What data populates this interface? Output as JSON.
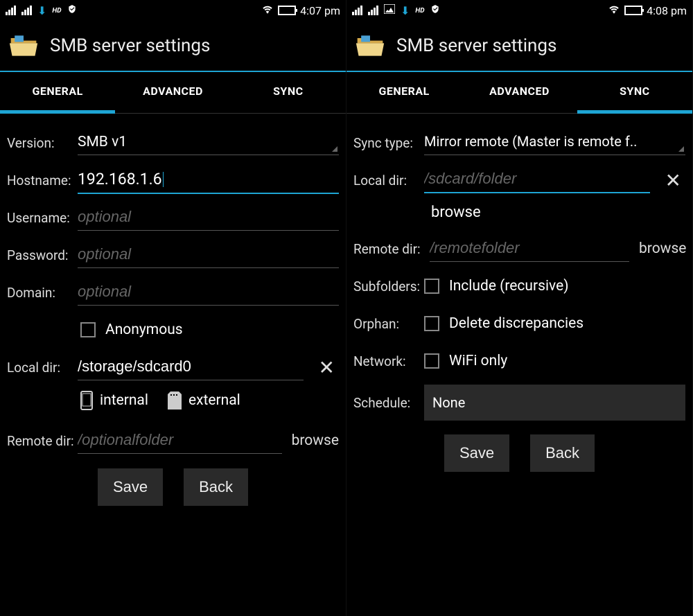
{
  "left": {
    "statusbar": {
      "hd": "HD",
      "time": "4:07 pm"
    },
    "title": "SMB server settings",
    "tabs": {
      "general": "GENERAL",
      "advanced": "ADVANCED",
      "sync": "SYNC"
    },
    "version_label": "Version:",
    "version_value": "SMB v1",
    "hostname_label": "Hostname:",
    "hostname_value": "192.168.1.6",
    "username_label": "Username:",
    "username_placeholder": "optional",
    "password_label": "Password:",
    "password_placeholder": "optional",
    "domain_label": "Domain:",
    "domain_placeholder": "optional",
    "anonymous_label": "Anonymous",
    "localdir_label": "Local dir:",
    "localdir_value": "/storage/sdcard0",
    "internal_label": "internal",
    "external_label": "external",
    "remotedir_label": "Remote dir:",
    "remotedir_placeholder": "/optionalfolder",
    "browse": "browse",
    "save": "Save",
    "back": "Back"
  },
  "right": {
    "statusbar": {
      "hd": "HD",
      "time": "4:08 pm"
    },
    "title": "SMB server settings",
    "tabs": {
      "general": "GENERAL",
      "advanced": "ADVANCED",
      "sync": "SYNC"
    },
    "synctype_label": "Sync type:",
    "synctype_value": "Mirror remote (Master is remote f..",
    "localdir_label": "Local dir:",
    "localdir_placeholder": "/sdcard/folder",
    "browse": "browse",
    "remotedir_label": "Remote dir:",
    "remotedir_placeholder": "/remotefolder",
    "subfolders_label": "Subfolders:",
    "subfolders_check": "Include (recursive)",
    "orphan_label": "Orphan:",
    "orphan_check": "Delete discrepancies",
    "network_label": "Network:",
    "network_check": "WiFi only",
    "schedule_label": "Schedule:",
    "schedule_value": "None",
    "save": "Save",
    "back": "Back"
  }
}
